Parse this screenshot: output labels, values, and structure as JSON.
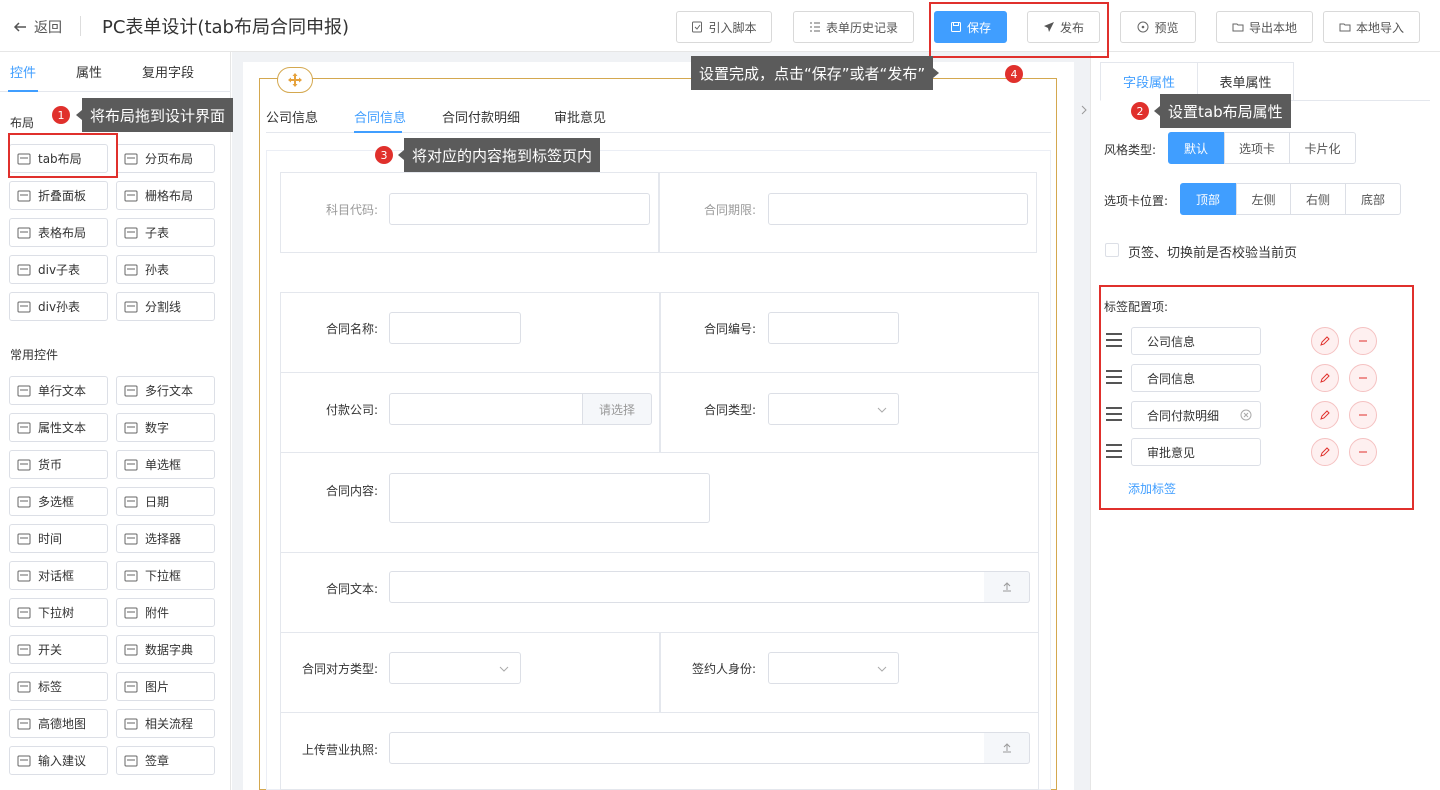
{
  "header": {
    "back_label": "返回",
    "title": "PC表单设计(tab布局合同申报)",
    "buttons": {
      "import_script": "引入脚本",
      "history": "表单历史记录",
      "save": "保存",
      "publish": "发布",
      "preview": "预览",
      "export_local": "导出本地",
      "import_local": "本地导入"
    }
  },
  "left": {
    "tabs": [
      "控件",
      "属性",
      "复用字段"
    ],
    "layout_title": "布局",
    "layout_items": [
      "tab布局",
      "分页布局",
      "折叠面板",
      "栅格布局",
      "表格布局",
      "子表",
      "div子表",
      "孙表",
      "div孙表",
      "分割线"
    ],
    "common_title": "常用控件",
    "common_items": [
      "单行文本",
      "多行文本",
      "属性文本",
      "数字",
      "货币",
      "单选框",
      "多选框",
      "日期",
      "时间",
      "选择器",
      "对话框",
      "下拉框",
      "下拉树",
      "附件",
      "开关",
      "数据字典",
      "标签",
      "图片",
      "高德地图",
      "相关流程",
      "输入建议",
      "签章"
    ]
  },
  "center": {
    "tabs": [
      "公司信息",
      "合同信息",
      "合同付款明细",
      "审批意见"
    ],
    "active_tab": "合同信息",
    "fields": {
      "subject_code": "科目代码:",
      "contract_period": "合同期限:",
      "contract_name": "合同名称:",
      "contract_no": "合同编号:",
      "pay_company": "付款公司:",
      "choose": "请选择",
      "contract_type": "合同类型:",
      "contract_content": "合同内容:",
      "contract_text": "合同文本:",
      "counterpart_type": "合同对方类型:",
      "signer_identity": "签约人身份:",
      "license_upload": "上传营业执照:"
    }
  },
  "right": {
    "tabs": [
      "字段属性",
      "表单属性"
    ],
    "style_label": "风格类型:",
    "style_options": [
      "默认",
      "选项卡",
      "卡片化"
    ],
    "style_selected": "默认",
    "position_label": "选项卡位置:",
    "position_options": [
      "顶部",
      "左侧",
      "右侧",
      "底部"
    ],
    "position_selected": "顶部",
    "validate_label": "页签、切换前是否校验当前页",
    "tags_label": "标签配置项:",
    "tags": [
      "公司信息",
      "合同信息",
      "合同付款明细",
      "审批意见"
    ],
    "add_tag": "添加标签"
  },
  "annotations": {
    "step1": {
      "num": "1",
      "text": "将布局拖到设计界面"
    },
    "step2": {
      "num": "2",
      "text": "设置tab布局属性"
    },
    "step3": {
      "num": "3",
      "text": "将对应的内容拖到标签页内"
    },
    "step4": {
      "num": "4",
      "text": "设置完成，点击“保存”或者“发布”"
    }
  },
  "colors": {
    "accent": "#409eff",
    "annotation": "#e0302c",
    "tooltip": "#5b5b5b",
    "guide": "#d4a84f"
  }
}
